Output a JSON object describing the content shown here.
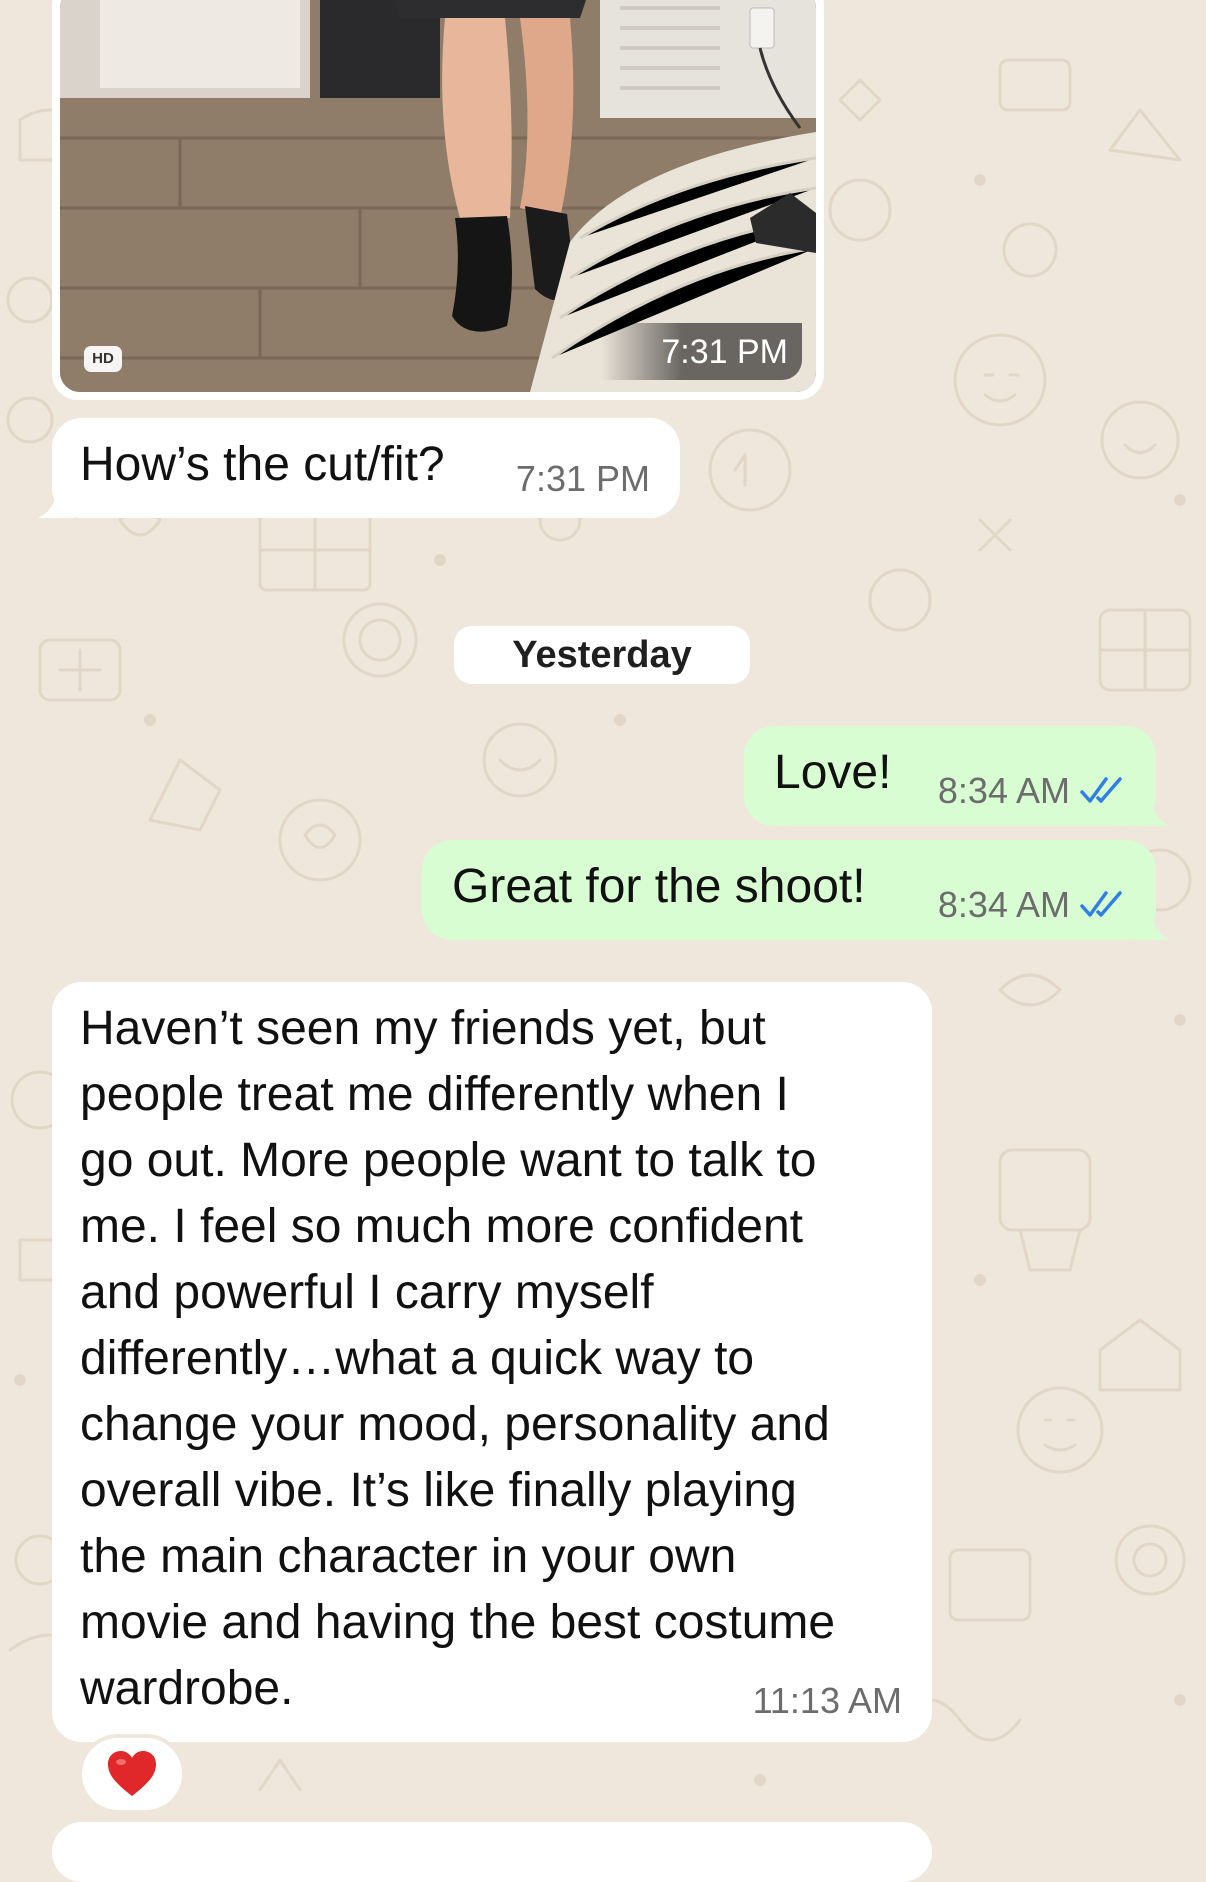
{
  "colors": {
    "wallpaper": "#efe7dc",
    "incoming_bubble": "#ffffff",
    "outgoing_bubble": "#d9fdd3",
    "read_ticks": "#2f7fe4",
    "heart": "#e0282a"
  },
  "image_message": {
    "badge": "HD",
    "time": "7:31 PM"
  },
  "messages": [
    {
      "direction": "in",
      "text": "How’s the cut/fit?",
      "time": "7:31 PM"
    },
    {
      "direction": "out",
      "text": "Love!",
      "time": "8:34 AM",
      "status_icon": "double-check-read-icon"
    },
    {
      "direction": "out",
      "text": "Great for the shoot!",
      "time": "8:34 AM",
      "status_icon": "double-check-read-icon"
    },
    {
      "direction": "in",
      "lines": [
        "Haven’t seen my friends yet, but",
        "people treat me differently when I",
        "go out. More people want to talk to",
        "me. I feel so much more confident",
        "and powerful I carry myself",
        "differently…what a quick way to",
        "change your mood, personality and",
        "overall vibe. It’s like finally playing",
        "the main character in your own",
        "movie and having the best costume",
        "wardrobe."
      ],
      "time": "11:13 AM",
      "reaction": "heart-icon"
    }
  ],
  "date_separator": "Yesterday"
}
